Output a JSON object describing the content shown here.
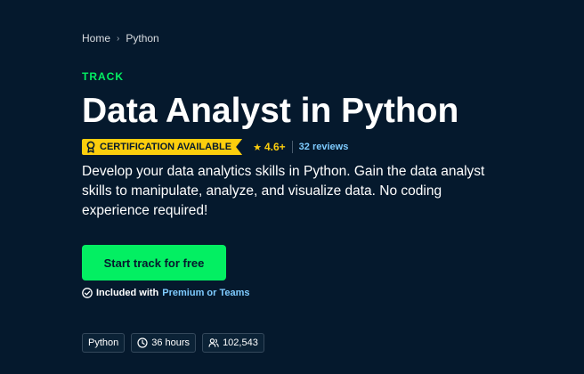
{
  "breadcrumb": {
    "home": "Home",
    "separator": "›",
    "current": "Python"
  },
  "eyebrow": "TRACK",
  "title": "Data Analyst in Python",
  "badge": {
    "label": "CERTIFICATION AVAILABLE",
    "icon": "certificate-ribbon-icon"
  },
  "rating": {
    "star": "★",
    "value": "4.6+",
    "reviews": "32 reviews"
  },
  "description": "Develop your data analytics skills in Python. Gain the data analyst skills to manipulate, analyze, and visualize data. No coding experience required!",
  "cta": {
    "label": "Start track for free"
  },
  "included": {
    "prefix": "Included with",
    "plans": "Premium or Teams"
  },
  "tags": {
    "technology": "Python",
    "duration": "36 hours",
    "learners": "102,543"
  },
  "colors": {
    "background": "#05192d",
    "accent_green": "#03ef62",
    "badge_yellow": "#fcce0d",
    "link_blue": "#7ecbff"
  }
}
